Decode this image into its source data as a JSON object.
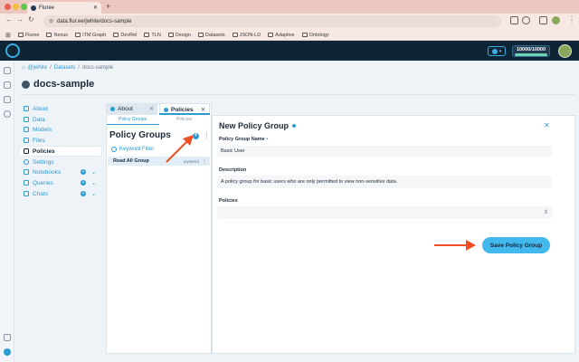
{
  "browser": {
    "tab_title": "Fluree",
    "url": "data.flur.ee/jwhite/docs-sample",
    "bookmarks": [
      "Fluree",
      "Nexus",
      "ITM Graph",
      "DevRel",
      "TLN",
      "Design",
      "Datasets",
      "JSON-LD",
      "Adaptive",
      "Ontology"
    ]
  },
  "header": {
    "credits": "10000/10000"
  },
  "breadcrumb": {
    "user": "@jwhite",
    "datasets": "Datasets",
    "current": "docs-sample"
  },
  "dataset": {
    "title": "docs-sample"
  },
  "nav": {
    "items": [
      {
        "label": "About"
      },
      {
        "label": "Data"
      },
      {
        "label": "Models"
      },
      {
        "label": "Files"
      },
      {
        "label": "Policies"
      },
      {
        "label": "Settings"
      },
      {
        "label": "Notebooks"
      },
      {
        "label": "Queries"
      },
      {
        "label": "Chats"
      }
    ]
  },
  "panel_tabs": {
    "about": "About",
    "policies": "Policies",
    "sub_policy_groups": "Policy Groups",
    "sub_policies": "Policies"
  },
  "policy_groups": {
    "heading": "Policy Groups",
    "filter_placeholder": "Keyword Filter",
    "items": [
      {
        "name": "Read All Group",
        "tag": "(system)"
      }
    ]
  },
  "form": {
    "title": "New Policy Group",
    "name_label": "Policy Group Name",
    "name_value": "Basic User",
    "description_label": "Description",
    "description_value": "A policy group for basic users who are only permitted to view non-sensitive data.",
    "policies_label": "Policies",
    "policies_value": "",
    "save_label": "Save Policy Group"
  },
  "colors": {
    "accent": "#2b9bd4",
    "header": "#0f2536",
    "annotation_arrow": "#f04e23"
  }
}
